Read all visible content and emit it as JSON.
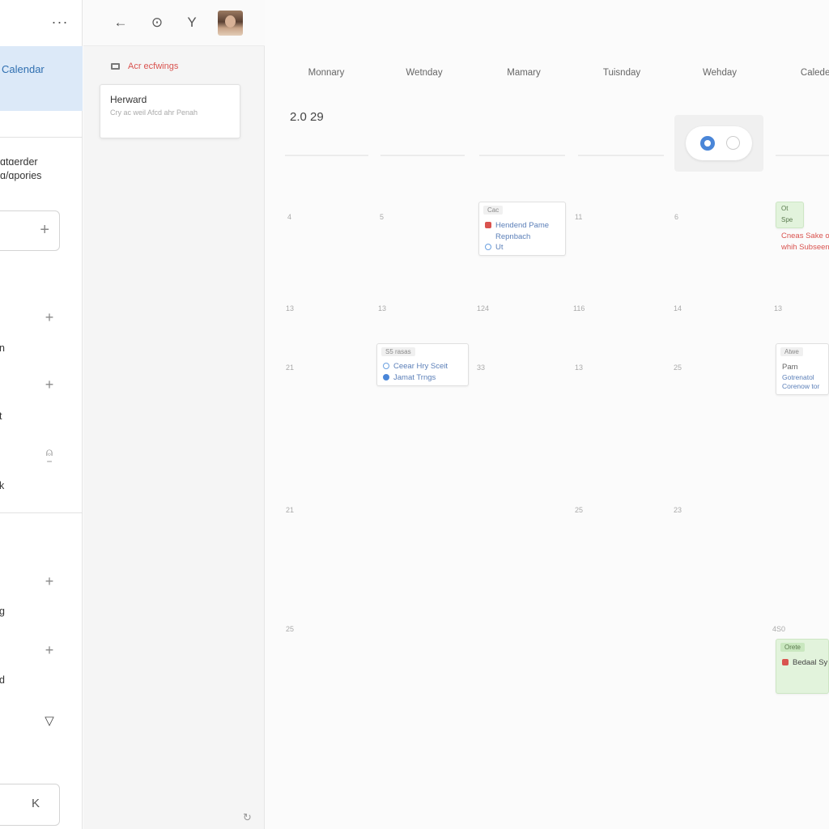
{
  "left_nav": {
    "more_icon": "more-horizontal-icon",
    "active_item_label": "Calendar",
    "group_title_line1": "ɑtɑerder",
    "group_title_line2": "ɑ/ɑpories",
    "search_add_icon": "plus-icon",
    "rows": [
      {
        "label": "n",
        "icon": "plus-icon",
        "glyph": "+"
      },
      {
        "label": "t",
        "icon": "plus-icon",
        "glyph": "+"
      },
      {
        "label": "k",
        "icon": "bell-icon",
        "glyph": "⍝"
      },
      {
        "label": "g",
        "icon": "plus-icon",
        "glyph": "+"
      },
      {
        "label": "d",
        "icon": "plus-icon",
        "glyph": "+"
      },
      {
        "label": "",
        "icon": "filter-icon",
        "glyph": "▽"
      }
    ],
    "collapse_icon": "collapse-icon",
    "collapse_glyph": "K"
  },
  "mid_panel": {
    "toolbar_icons": [
      "back-arrow-icon",
      "target-icon",
      "filter-y-icon"
    ],
    "toolbar_glyphs": [
      "←",
      "⊙",
      "Y"
    ],
    "heading": "Acr ecfwings",
    "card_title": "Herward",
    "card_subtitle": "Cry ac weil Afcd ahr Penah",
    "refresh_icon": "refresh-icon",
    "refresh_glyph": "↻"
  },
  "calendar": {
    "day_headers": [
      "Monnary",
      "Wetnday",
      "Mamary",
      "Tuisnday",
      "Wehday",
      "Caledes"
    ],
    "date_label": "2.0 29",
    "toggle": {
      "on_icon": "toggle-on-icon",
      "off_icon": "toggle-off-icon"
    },
    "day_numbers": {
      "r1": [
        "4",
        "5",
        "11",
        "6"
      ],
      "r2": [
        "13",
        "13",
        "124",
        "116",
        "14",
        "13"
      ],
      "r3": [
        "21",
        "33",
        "13",
        "25"
      ],
      "r4": [
        "21",
        "25",
        "23"
      ],
      "r5": [
        "25",
        "4S0"
      ]
    },
    "events": {
      "wed_event": {
        "tag": "Cac",
        "line1": "Hendend Pame",
        "line2": "Repnbach",
        "line3": "Ut"
      },
      "fri_event": {
        "tag": "Ot",
        "tag2": "Spe",
        "line1": "Cneas Sake o",
        "line2": "whih Subseen"
      },
      "tue_event": {
        "tag": "S5 rasas",
        "line1": "Ceear Hry Sceit",
        "line2": "Jamat Trngs"
      },
      "fri_event2": {
        "tag": "Atwe",
        "line1": "Pam",
        "line2": "Gotrenatol",
        "line3": "Corenow tor"
      },
      "fri_event3": {
        "tag": "Orete",
        "line1": "Bedaal Sy"
      }
    }
  },
  "colors": {
    "accent_blue": "#4a86d8",
    "active_nav_bg": "#dce9f8",
    "event_red": "#d9534f",
    "event_green_bg": "#e2f3dc"
  }
}
